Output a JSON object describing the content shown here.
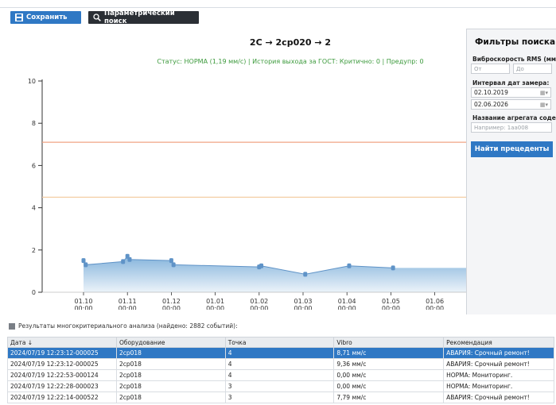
{
  "toolbar": {
    "save_label": "Сохранить",
    "param_search_label": "Параметрический поиск"
  },
  "chart": {
    "title": "2C → 2cp020 → 2",
    "status": "Статус: НОРМА (1,19 мм/с) | История выхода за ГОСТ: Критично: 0 | Предупр: 0"
  },
  "chart_data": {
    "type": "area",
    "title": "2C → 2cp020 → 2",
    "ylim": [
      0,
      10
    ],
    "y_ticks": [
      "0",
      "2",
      "4",
      "6",
      "8",
      "10"
    ],
    "x_ticks": [
      [
        "01.10",
        "00:00"
      ],
      [
        "01.11",
        "00:00"
      ],
      [
        "01.12",
        "00:00"
      ],
      [
        "01.01",
        "00:00"
      ],
      [
        "01.02",
        "00:00"
      ],
      [
        "01.03",
        "00:00"
      ],
      [
        "01.04",
        "00:00"
      ],
      [
        "01.05",
        "00:00"
      ],
      [
        "01.06",
        "00:00"
      ]
    ],
    "threshold_critical": 7.1,
    "threshold_warning": 4.5,
    "points": [
      {
        "x": 1.0,
        "y": 1.5
      },
      {
        "x": 1.05,
        "y": 1.3
      },
      {
        "x": 1.9,
        "y": 1.45
      },
      {
        "x": 2.0,
        "y": 1.7
      },
      {
        "x": 2.05,
        "y": 1.55
      },
      {
        "x": 3.0,
        "y": 1.5
      },
      {
        "x": 3.05,
        "y": 1.3
      },
      {
        "x": 5.0,
        "y": 1.2
      },
      {
        "x": 5.05,
        "y": 1.25
      },
      {
        "x": 6.05,
        "y": 0.85
      },
      {
        "x": 7.05,
        "y": 1.25
      },
      {
        "x": 8.05,
        "y": 1.15
      }
    ],
    "colors": {
      "critical": "#f0a484",
      "warning": "#f3c89a",
      "area": "#7fb0da",
      "marker": "#5f93c7"
    }
  },
  "filters": {
    "title": "Фильтры поиска",
    "rms_label": "Виброскорость RMS (мм/с):",
    "rms_from_placeholder": "От",
    "rms_to_placeholder": "До",
    "date_label": "Интервал дат замера:",
    "date_from": "02.10.2019",
    "date_to": "02.06.2026",
    "unit_label": "Название агрегата содержит:",
    "unit_placeholder": "Например: 1аа008",
    "find_button": "Найти прецеденты"
  },
  "results": {
    "caption": "Результаты многокритериального анализа (найдено: 2882 событий):",
    "columns": [
      "Дата ↓",
      "Оборудование",
      "Точка",
      "Vibro",
      "Рекомендация"
    ],
    "rows": [
      [
        "2024/07/19 12:23:12-000025",
        "2cp018",
        "4",
        "8,71 мм/с",
        "АВАРИЯ: Срочный ремонт!"
      ],
      [
        "2024/07/19 12:23:12-000025",
        "2cp018",
        "4",
        "9,36 мм/с",
        "АВАРИЯ: Срочный ремонт!"
      ],
      [
        "2024/07/19 12:22:53-000124",
        "2cp018",
        "4",
        "0,00 мм/с",
        "НОРМА: Мониторинг."
      ],
      [
        "2024/07/19 12:22:28-000023",
        "2cp018",
        "3",
        "0,00 мм/с",
        "НОРМА: Мониторинг."
      ],
      [
        "2024/07/19 12:22:14-000522",
        "2cp018",
        "3",
        "7,79 мм/с",
        "АВАРИЯ: Срочный ремонт!"
      ]
    ],
    "selected_row": 0
  }
}
